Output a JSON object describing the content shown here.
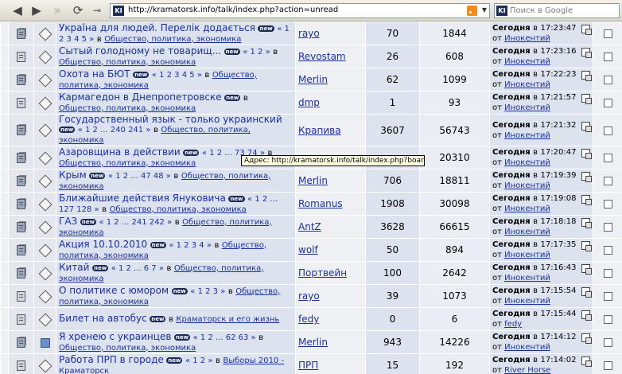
{
  "toolbar": {
    "url": "http://kramatorsk.info/talk/index.php?action=unread",
    "search_placeholder": "Поиск в Google",
    "site_icon_label": "KI"
  },
  "status_tooltip": "Адрес: http://kramatorsk.info/talk/index.php?board=3.0",
  "labels": {
    "in": "в",
    "from": "от",
    "at": "в"
  },
  "topics": [
    {
      "title": "Україна для людей. Перелік додається",
      "pages": "« 1 2 3 4 5 »",
      "board": "Общество, политика, экономика",
      "starter": "rayo",
      "replies": "70",
      "views": "1844",
      "last_date": "Сегодня",
      "last_time": "17:23:47",
      "last_by": "Инокентий",
      "hot": true,
      "poll": false
    },
    {
      "title": "Сытый голодному не товарищ...",
      "pages": "« 1 2 »",
      "board": "Общество, политика, экономика",
      "starter": "Revostam",
      "replies": "26",
      "views": "608",
      "last_date": "Сегодня",
      "last_time": "17:23:16",
      "last_by": "Инокентий",
      "hot": false,
      "poll": false
    },
    {
      "title": "Охота на БЮТ",
      "pages": "« 1 2 3 4 5 »",
      "board": "Общество, политика, экономика",
      "starter": "Merlin",
      "replies": "62",
      "views": "1099",
      "last_date": "Сегодня",
      "last_time": "17:22:23",
      "last_by": "Инокентий",
      "hot": true,
      "poll": false
    },
    {
      "title": "Кармагедон в Днепропетровске",
      "pages": "",
      "board": "Общество, политика, экономика",
      "starter": "dmp",
      "replies": "1",
      "views": "93",
      "last_date": "Сегодня",
      "last_time": "17:21:57",
      "last_by": "Инокентий",
      "hot": false,
      "poll": false
    },
    {
      "title": "Государственный язык - только украинский",
      "pages": "« 1 2 ... 240 241 »",
      "board": "Общество, политика, экономика",
      "starter": "Крапива",
      "replies": "3607",
      "views": "56743",
      "last_date": "Сегодня",
      "last_time": "17:21:32",
      "last_by": "Инокентий",
      "hot": true,
      "poll": false
    },
    {
      "title": "Азаровщина в действии",
      "pages": "« 1 2 ... 73 74 »",
      "board": "Общество, политика, экономика",
      "starter": "",
      "replies": "",
      "views": "20310",
      "last_date": "Сегодня",
      "last_time": "17:20:47",
      "last_by": "Инокентий",
      "hot": true,
      "poll": false
    },
    {
      "title": "Крым",
      "pages": "« 1 2 ... 47 48 »",
      "board": "Общество, политика, экономика",
      "starter": "Merlin",
      "replies": "706",
      "views": "18811",
      "last_date": "Сегодня",
      "last_time": "17:19:39",
      "last_by": "Инокентий",
      "hot": true,
      "poll": false
    },
    {
      "title": "Ближайшие действия Януковича",
      "pages": "« 1 2 ... 127 128 »",
      "board": "Общество, политика, экономика",
      "starter": "Romanus",
      "replies": "1908",
      "views": "30098",
      "last_date": "Сегодня",
      "last_time": "17:19:08",
      "last_by": "Инокентий",
      "hot": true,
      "poll": false
    },
    {
      "title": "ГАЗ",
      "pages": "« 1 2 ... 241 242 »",
      "board": "Общество, политика, экономика",
      "starter": "AntZ",
      "replies": "3628",
      "views": "66615",
      "last_date": "Сегодня",
      "last_time": "17:18:18",
      "last_by": "Инокентий",
      "hot": true,
      "poll": false
    },
    {
      "title": "Акция 10.10.2010",
      "pages": "« 1 2 3 4 »",
      "board": "Общество, политика, экономика",
      "starter": "wolf",
      "replies": "50",
      "views": "894",
      "last_date": "Сегодня",
      "last_time": "17:17:35",
      "last_by": "Инокентий",
      "hot": true,
      "poll": false
    },
    {
      "title": "Китай",
      "pages": "« 1 2 ... 6 7 »",
      "board": "Общество, политика, экономика",
      "starter": "Портвейн",
      "replies": "100",
      "views": "2642",
      "last_date": "Сегодня",
      "last_time": "17:16:43",
      "last_by": "Инокентий",
      "hot": true,
      "poll": false
    },
    {
      "title": "О политике с юмором",
      "pages": "« 1 2 3 »",
      "board": "Общество, политика, экономика",
      "starter": "rayo",
      "replies": "39",
      "views": "1073",
      "last_date": "Сегодня",
      "last_time": "17:15:54",
      "last_by": "Инокентий",
      "hot": false,
      "poll": false
    },
    {
      "title": "Билет на автобус",
      "pages": "",
      "board": "Краматорск и его жизнь",
      "starter": "fedy",
      "replies": "0",
      "views": "6",
      "last_date": "Сегодня",
      "last_time": "17:15:44",
      "last_by": "fedy",
      "hot": false,
      "poll": false
    },
    {
      "title": "Я хренею с украинцев",
      "pages": "« 1 2 ... 62 63 »",
      "board": "Общество, политика, экономика",
      "starter": "Merlin",
      "replies": "943",
      "views": "14226",
      "last_date": "Сегодня",
      "last_time": "17:14:12",
      "last_by": "Инокентий",
      "hot": true,
      "poll": true
    },
    {
      "title": "Работа ПРП в городе",
      "pages": "« 1 2 »",
      "board": "Выборы 2010 - Краматорск",
      "starter": "ПРП",
      "replies": "15",
      "views": "192",
      "last_date": "Сегодня",
      "last_time": "17:14:02",
      "last_by": "River Horse",
      "hot": false,
      "poll": false
    }
  ]
}
